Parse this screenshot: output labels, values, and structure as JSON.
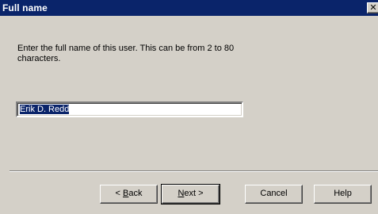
{
  "window": {
    "title": "Full name",
    "close_glyph": "✕"
  },
  "body": {
    "instruction": "Enter the full name of this user.  This can be from 2 to 80 characters."
  },
  "input": {
    "value": "Erik D. Redd"
  },
  "buttons": {
    "back_prefix": "< ",
    "back_mnemonic": "B",
    "back_rest": "ack",
    "next_mnemonic": "N",
    "next_rest": "ext >",
    "cancel": "Cancel",
    "help": "Help"
  },
  "colors": {
    "titlebar": "#0a246a",
    "dialog_face": "#d4d0c8",
    "selection": "#0a246a"
  }
}
